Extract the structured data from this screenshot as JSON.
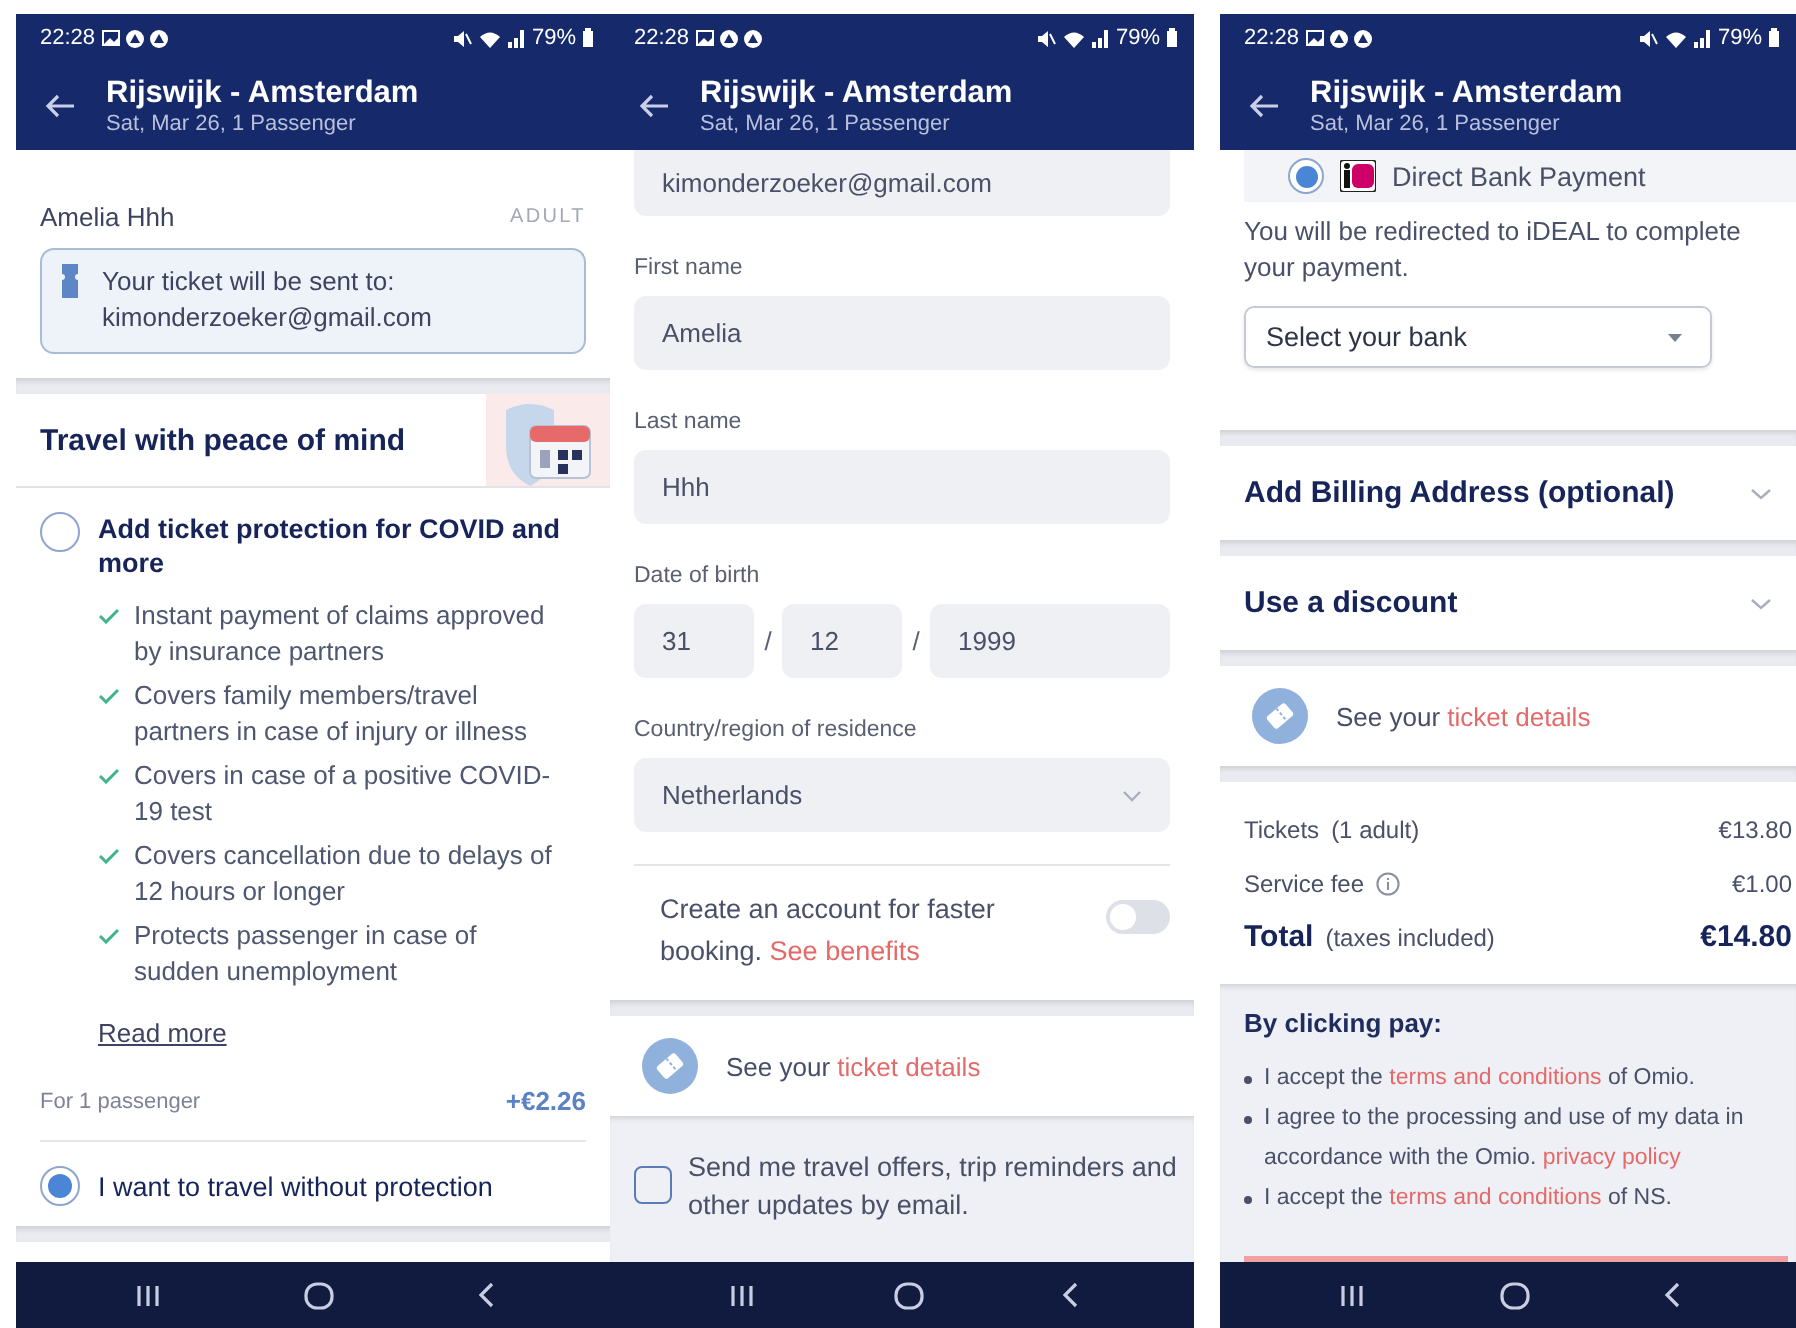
{
  "screens": [
    {
      "status_bar": {
        "time": "22:28",
        "battery": "79%"
      },
      "header": {
        "title": "Rijswijk - Amsterdam",
        "subtitle": "Sat, Mar 26, 1 Passenger"
      },
      "passenger": {
        "name": "Amelia Hhh",
        "type": "ADULT",
        "notice": "Your ticket will be sent to:",
        "email": "kimonderzoeker@gmail.com"
      },
      "protection": {
        "title": "Travel with peace of mind",
        "options": [
          {
            "kind": "offer",
            "label": "Add ticket protection for COVID and more",
            "selected": false,
            "benefits": [
              "Instant payment of claims approved by insurance partners",
              "Covers family members/travel partners in case of injury or illness",
              "Covers in case of a positive COVID-19 test",
              "Covers cancellation due to delays of 12 hours or longer",
              "Protects passenger in case of sudden unemployment"
            ],
            "read_more": "Read more",
            "price_label": "For 1 passenger",
            "price": "+€2.26"
          },
          {
            "kind": "plain",
            "label": "I want to travel without protection",
            "selected": true
          }
        ]
      }
    },
    {
      "status_bar": {
        "time": "22:28",
        "battery": "79%"
      },
      "header": {
        "title": "Rijswijk - Amsterdam",
        "subtitle": "Sat, Mar 26, 1 Passenger"
      },
      "form": {
        "email": "kimonderzoeker@gmail.com",
        "fields": [
          {
            "label": "First name",
            "value": "Amelia"
          },
          {
            "label": "Last name",
            "value": "Hhh"
          }
        ],
        "date_of_birth": {
          "label": "Date of birth",
          "parts": [
            "31",
            "12",
            "1999"
          ],
          "separators": [
            "/",
            "/"
          ]
        },
        "country": {
          "label": "Country/region of residence",
          "value": "Netherlands"
        }
      },
      "account": {
        "text": "Create an account for faster booking.",
        "link": "See benefits",
        "on": false
      },
      "ticket_details": {
        "text": "See your",
        "link": "ticket details"
      },
      "newsletter": {
        "label": "Send me travel offers, trip reminders and other updates by email.",
        "checked": false
      }
    },
    {
      "status_bar": {
        "time": "22:28",
        "battery": "79%"
      },
      "header": {
        "title": "Rijswijk - Amsterdam",
        "subtitle": "Sat, Mar 26, 1 Passenger"
      },
      "payment": {
        "method": "Direct Bank Payment",
        "selected": true,
        "note": "You will be redirected to iDEAL to complete your payment.",
        "bank_select": {
          "placeholder": "Select your bank"
        }
      },
      "sections": [
        {
          "title": "Add Billing Address (optional)",
          "expanded": false
        },
        {
          "title": "Use a discount",
          "expanded": false
        }
      ],
      "ticket_details": {
        "text": "See your",
        "link": "ticket details"
      },
      "summary": [
        {
          "kind": "line",
          "label": "Tickets",
          "note": "(1 adult)",
          "amount": "€13.80"
        },
        {
          "kind": "info",
          "label": "Service fee",
          "amount": "€1.00"
        },
        {
          "kind": "total",
          "label": "Total",
          "note": "(taxes included)",
          "amount": "€14.80"
        }
      ],
      "terms": {
        "title": "By clicking pay:",
        "items": [
          {
            "before": "I accept the",
            "link": "terms and conditions",
            "after": "of Omio."
          },
          {
            "before": "I agree to the processing and use of my data in accordance with the Omio.",
            "link": "privacy policy"
          },
          {
            "before": "I accept the",
            "link": "terms and conditions",
            "after": "of NS."
          }
        ]
      }
    }
  ]
}
